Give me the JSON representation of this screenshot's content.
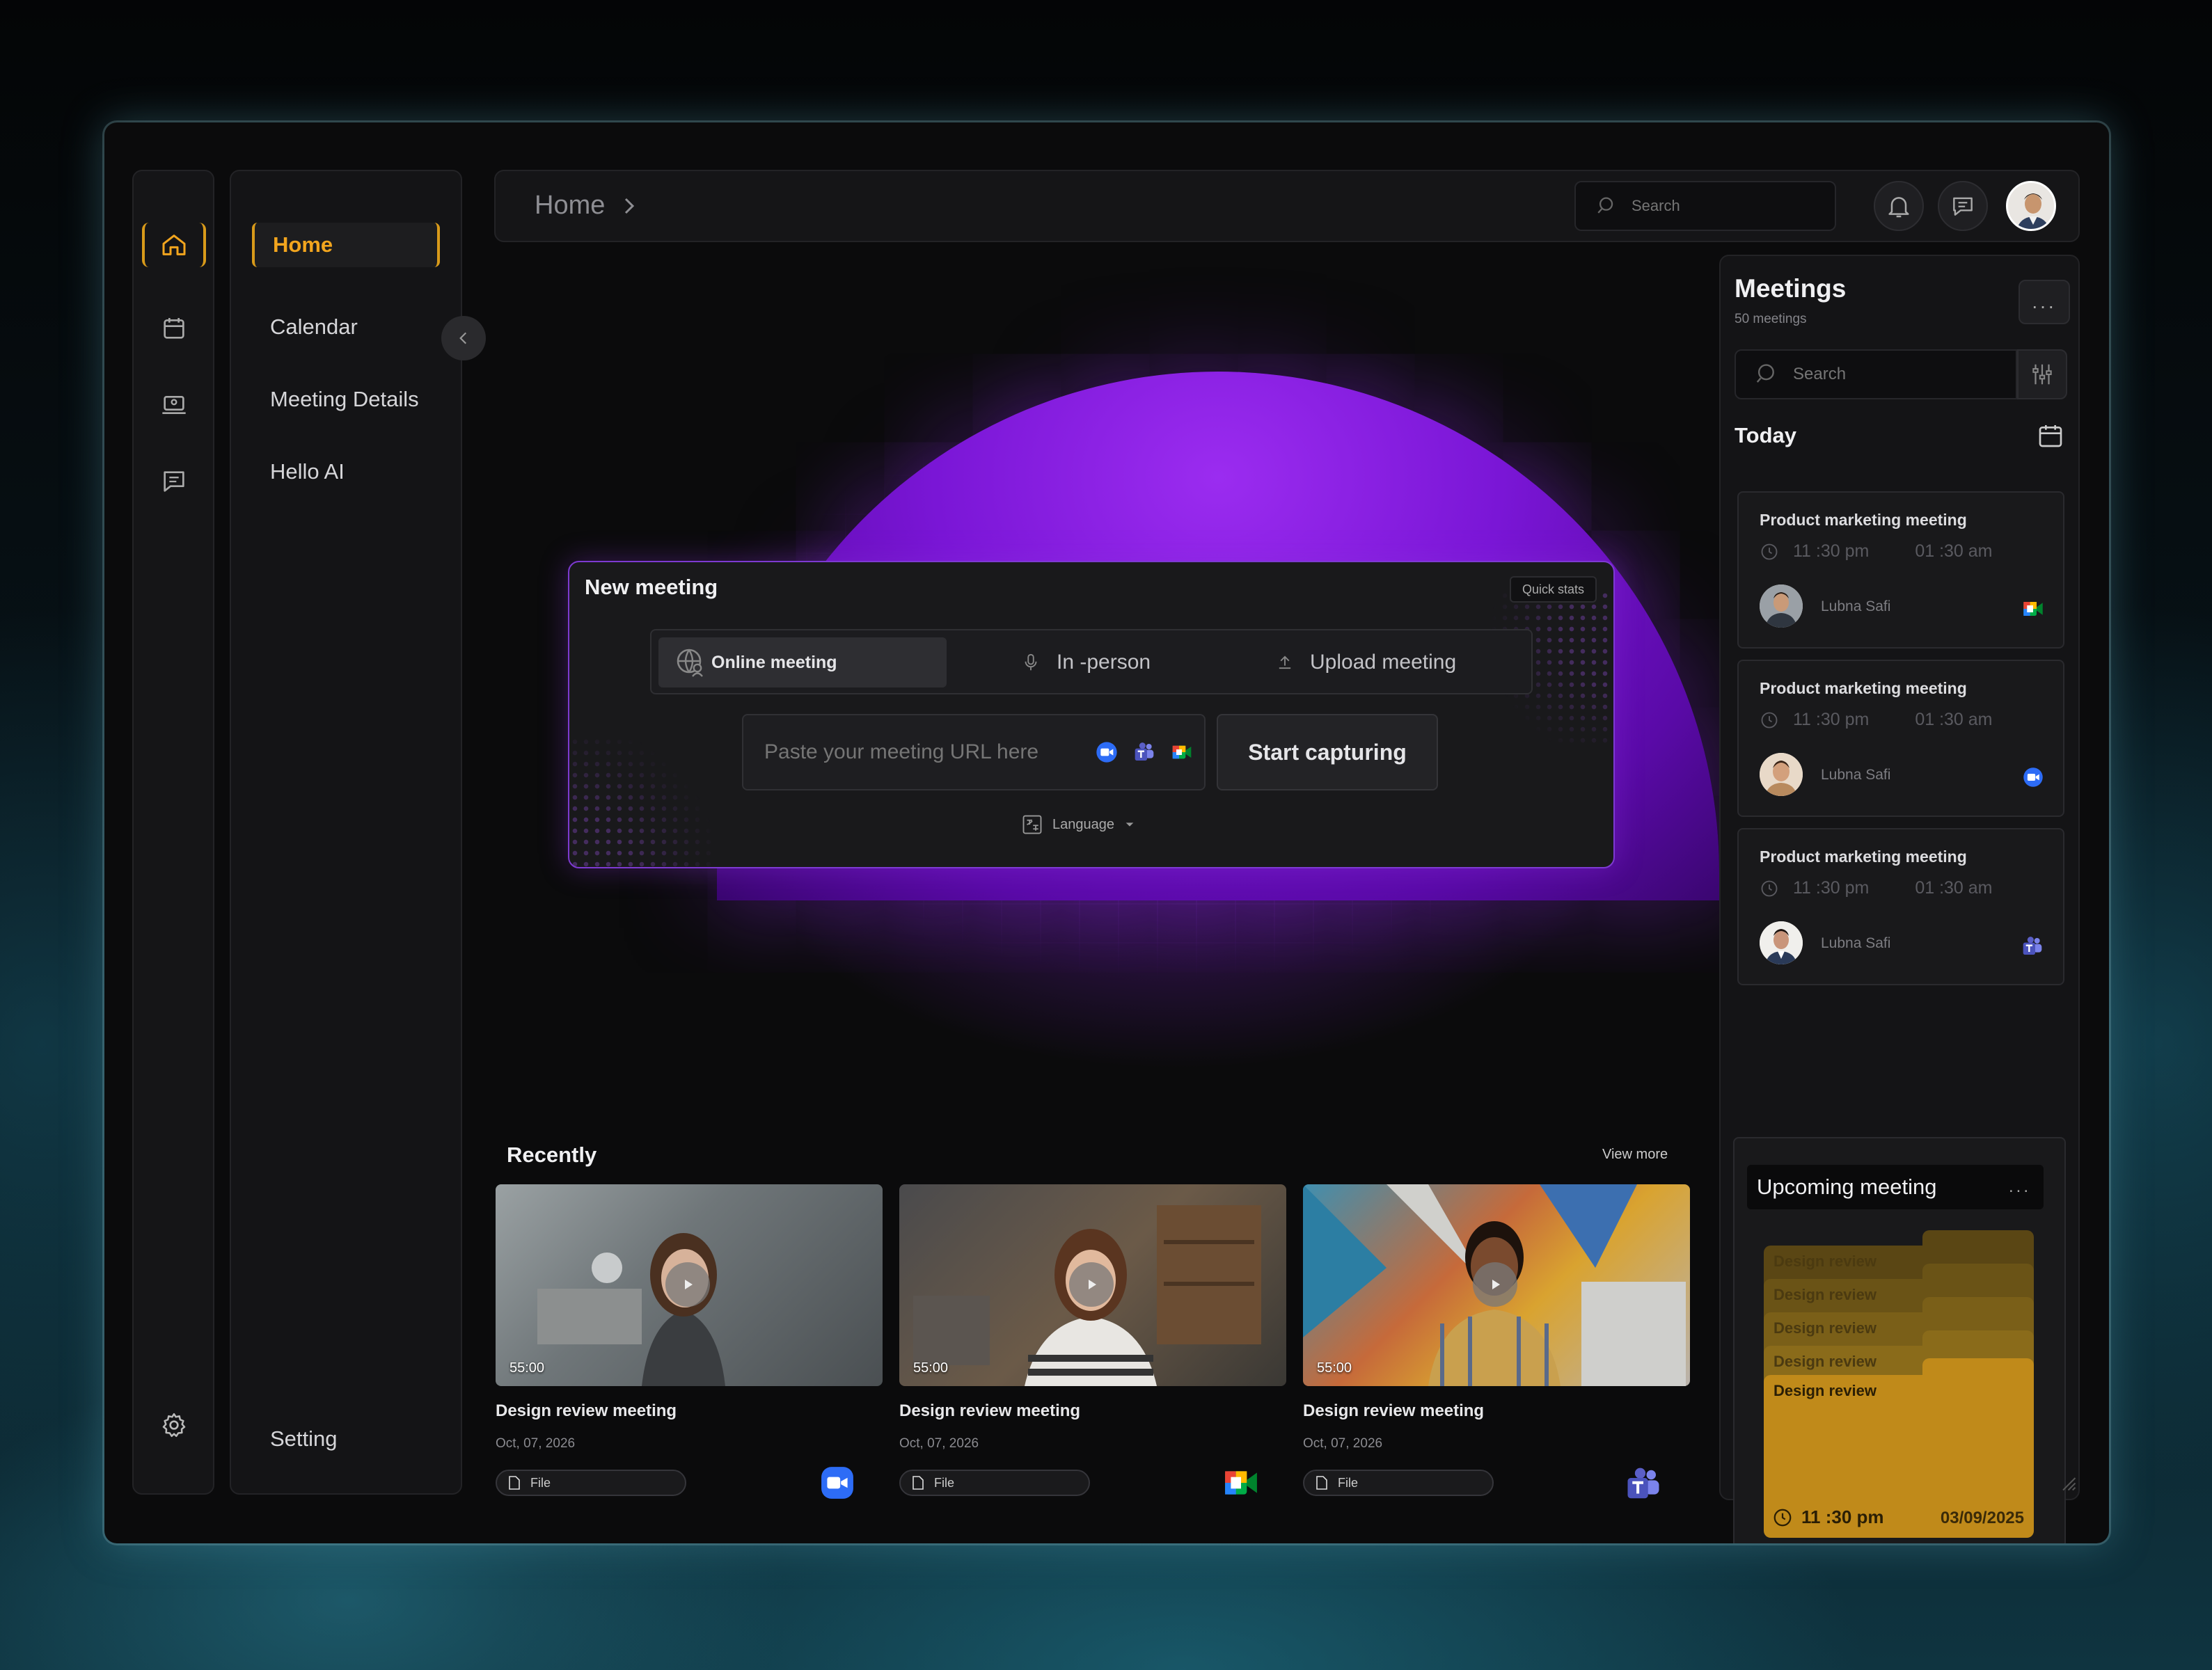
{
  "colors": {
    "accent": "#f2a51e",
    "purple": "#8a2be2",
    "panel": "#141416",
    "window": "#0b0b0c"
  },
  "icons": {
    "rail": [
      "home-icon",
      "calendar-icon",
      "laptop-icon",
      "chat-icon",
      "gear-icon"
    ],
    "topbar": [
      "search-icon",
      "bell-icon",
      "message-icon"
    ]
  },
  "nav": {
    "items": [
      {
        "label": "Home",
        "active": true
      },
      {
        "label": "Calendar"
      },
      {
        "label": "Meeting Details"
      },
      {
        "label": "Hello AI"
      }
    ],
    "setting_label": "Setting"
  },
  "topbar": {
    "breadcrumb": "Home",
    "search_placeholder": "Search"
  },
  "new_meeting": {
    "title": "New meeting",
    "quick_stats": "Quick stats",
    "tabs": [
      {
        "label": "Online meeting",
        "active": true,
        "icon": "globe-user-icon"
      },
      {
        "label": "In -person",
        "icon": "microphone-icon"
      },
      {
        "label": "Upload meeting",
        "icon": "upload-icon"
      }
    ],
    "url_placeholder": "Paste your meeting URL here",
    "start_label": "Start capturing",
    "language_label": "Language"
  },
  "recently": {
    "title": "Recently",
    "view_more": "View more",
    "cards": [
      {
        "duration": "55:00",
        "title": "Design review meeting",
        "date": "Oct, 07, 2026",
        "file": "File",
        "platform": "zoom"
      },
      {
        "duration": "55:00",
        "title": "Design review meeting",
        "date": "Oct, 07, 2026",
        "file": "File",
        "platform": "google-meet"
      },
      {
        "duration": "55:00",
        "title": "Design review meeting",
        "date": "Oct, 07, 2026",
        "file": "File",
        "platform": "teams"
      }
    ]
  },
  "meetings": {
    "title": "Meetings",
    "count": "50 meetings",
    "more": "...",
    "search_placeholder": "Search",
    "today": "Today",
    "list": [
      {
        "title": "Product marketing meeting",
        "start": "11 :30 pm",
        "end": "01 :30 am",
        "person": "Lubna Safi",
        "platform": "google-meet"
      },
      {
        "title": "Product marketing meeting",
        "start": "11 :30 pm",
        "end": "01 :30 am",
        "person": "Lubna Safi",
        "platform": "zoom"
      },
      {
        "title": "Product marketing meeting",
        "start": "11 :30 pm",
        "end": "01 :30 am",
        "person": "Lubna Safi",
        "platform": "teams"
      }
    ],
    "upcoming": {
      "title": "Upcoming meeting",
      "more": "...",
      "stack": [
        "Design review",
        "Design review",
        "Design review",
        "Design review"
      ],
      "front": {
        "title": "Design review",
        "time": "11 :30 pm",
        "date": "03/09/2025"
      }
    }
  }
}
